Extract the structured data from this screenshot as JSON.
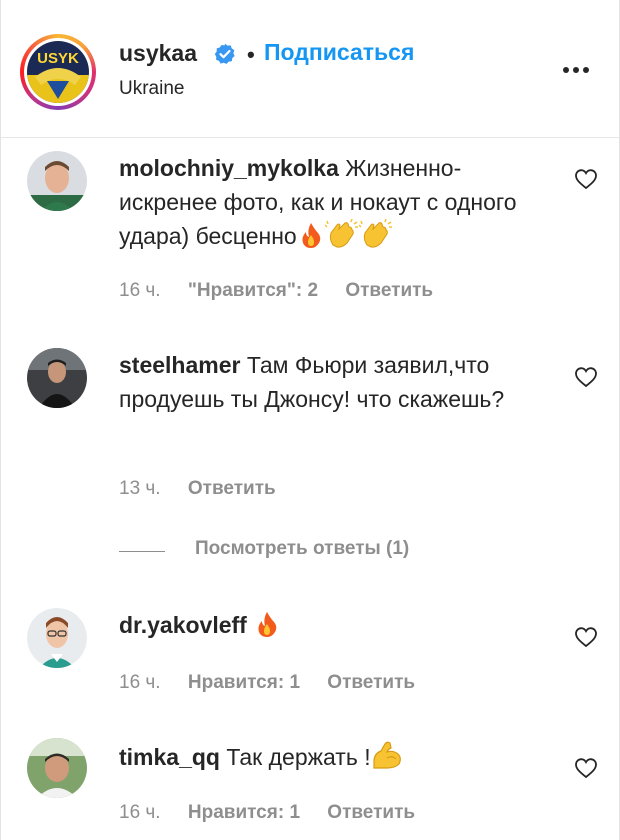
{
  "post_header": {
    "username": "usykaa",
    "separator": "•",
    "follow_label": "Подписаться",
    "location": "Ukraine",
    "verified": true,
    "more_icon": "more-horizontal-icon"
  },
  "comments": [
    {
      "username": "molochniy_mykolka",
      "text": "Жизненно-искренее фото, как и нокаут с одного удара) бесценно",
      "emojis": [
        "fire",
        "clapping-hands",
        "clapping-hands"
      ],
      "time": "16 ч.",
      "likes": "\"Нравится\": 2",
      "reply_label": "Ответить"
    },
    {
      "username": "steelhamer",
      "text": "Там Фьюри заявил,что продуешь ты Джонсу! что скажешь?",
      "time": "13 ч.",
      "reply_label": "Ответить",
      "view_replies": "Посмотреть ответы (1)"
    },
    {
      "username": "dr.yakovleff",
      "text": "",
      "emojis": [
        "fire"
      ],
      "time": "16 ч.",
      "likes": "Нравится: 1",
      "reply_label": "Ответить"
    },
    {
      "username": "timka_qq",
      "text": "Так держать !",
      "emojis": [
        "flexed-biceps"
      ],
      "time": "16 ч.",
      "likes": "Нравится: 1",
      "reply_label": "Ответить"
    }
  ],
  "colors": {
    "link": "#1596f3",
    "meta": "#8e8e8e",
    "text": "#262626",
    "divider": "#e6e6e6"
  }
}
